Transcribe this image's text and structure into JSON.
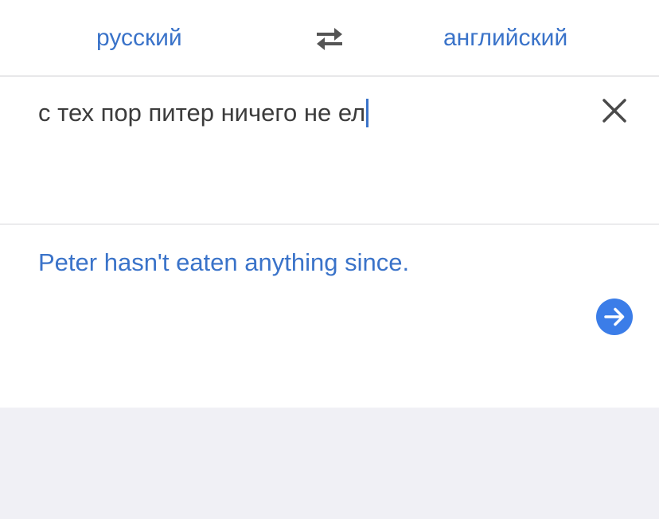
{
  "languages": {
    "source": "русский",
    "target": "английский"
  },
  "input": {
    "text": "с тех пор питер ничего не ел"
  },
  "output": {
    "translation": "Peter hasn't eaten anything since."
  },
  "icons": {
    "swap": "swap-arrows-icon",
    "clear": "close-icon",
    "go": "arrow-right-circle-icon"
  },
  "colors": {
    "accent": "#3a73c9",
    "go_button": "#3b7de8",
    "input_text": "#3c3c3c",
    "background_lower": "#f0f0f5"
  }
}
